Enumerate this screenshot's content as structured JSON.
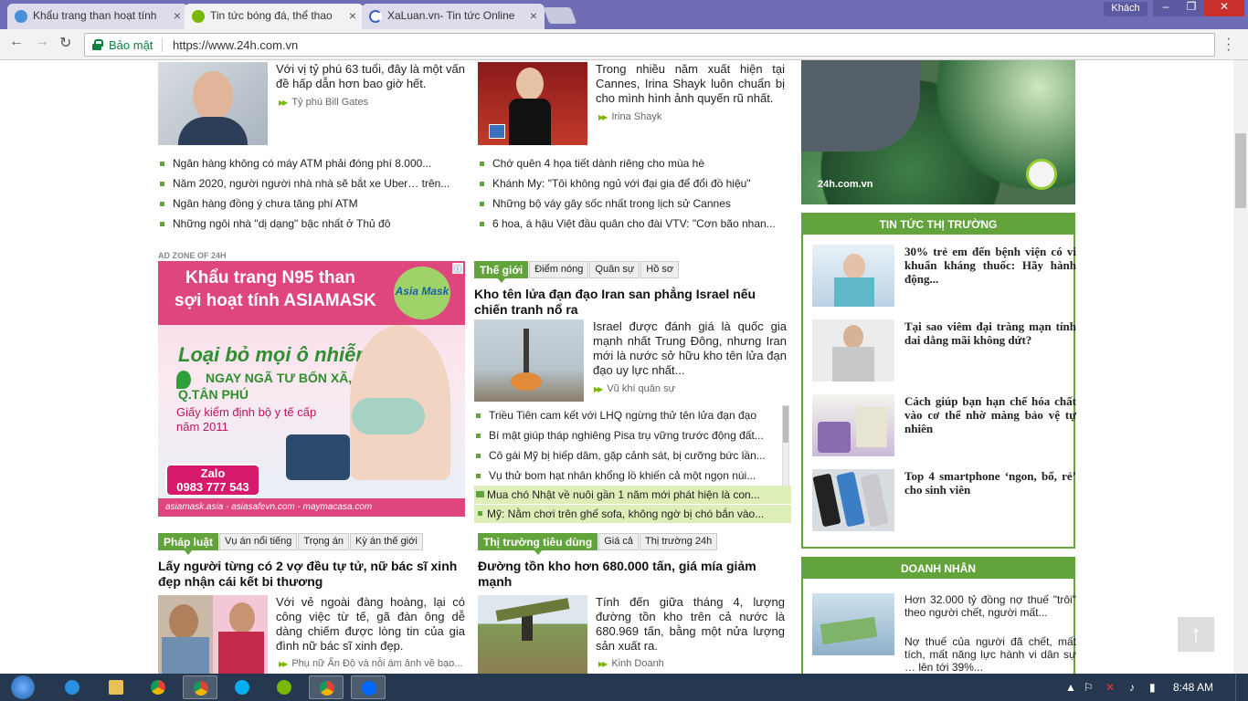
{
  "browser": {
    "tabs": [
      {
        "title": "Khẩu trang than hoạt tính"
      },
      {
        "title": "Tin tức bóng đá, thể thao"
      },
      {
        "title": "XaLuan.vn- Tin tức Online"
      }
    ],
    "guest_label": "Khách",
    "secure_label": "Bảo mật",
    "url": "https://www.24h.com.vn",
    "win_buttons": {
      "min": "–",
      "max": "❐",
      "close": "✕"
    }
  },
  "top_left": {
    "text": "Với vị tỷ phú 63 tuổi, đây là một vấn đề hấp dẫn hơn bao giờ hết.",
    "tag": "Tỷ phú Bill Gates",
    "links": [
      "Ngân hàng không có máy ATM phải đóng phí 8.000...",
      "Năm 2020, người người nhà nhà sẽ bắt xe Uber… trên...",
      "Ngân hàng đồng ý chưa tăng phí ATM",
      "Những ngôi nhà \"dị dạng\" bậc nhất ở Thủ đô"
    ]
  },
  "top_mid": {
    "text": "Trong nhiều năm xuất hiện tại Cannes, Irina Shayk luôn chuẩn bị cho mình hình ảnh quyến rũ nhất.",
    "tag": "Irina Shayk",
    "links": [
      "Chớ quên 4 họa tiết dành riêng cho mùa hè",
      "Khánh My: \"Tôi không ngủ với đại gia để đổi đồ hiệu\"",
      "Những bộ váy gây sốc nhất trong lịch sử Cannes",
      "6 hoa, á hậu Việt đầu quân cho đài VTV: \"Cơn bão nhan..."
    ]
  },
  "ad": {
    "zone_label": "AD ZONE OF 24H",
    "line1": "Khẩu trang N95 than",
    "line2": "sợi hoạt tính ASIAMASK",
    "brand": "Asia Mask",
    "headline": "Loại bỏ mọi ô nhiễm",
    "address1": "NGAY NGÃ TƯ BỐN XÃ,",
    "address2": "Q.TÂN PHÚ",
    "cert1": "Giấy kiểm định bộ y tế cấp",
    "cert2": "năm 2011",
    "zalo": "Zalo",
    "phone": "0983 777 543",
    "sites": "asiamask.asia - asiasafevn.com - maymacasa.com"
  },
  "world": {
    "tabs": [
      "Thế giới",
      "Điểm nóng",
      "Quân sự",
      "Hồ sơ"
    ],
    "headline": "Kho tên lửa đạn đạo Iran san phẳng Israel nếu chiến tranh nổ ra",
    "text": "Israel được đánh giá là quốc gia mạnh nhất Trung Đông, nhưng Iran mới là nước sở hữu kho tên lửa đạn đạo uy lực nhất...",
    "tag": "Vũ khí quân sự",
    "links": [
      "Triều Tiên cam kết với LHQ ngừng thử tên lửa đạn đạo",
      "Bí mật giúp tháp nghiêng Pisa trụ vững trước động đất...",
      "Cô gái Mỹ bị hiếp dâm, gặp cảnh sát, bị cưỡng bức lần...",
      "Vụ thử bom hạt nhân khổng lồ khiến cả một ngọn núi..."
    ],
    "video_links": [
      "Mua chó Nhật về nuôi gần 1 năm mới phát hiện là con...",
      "Mỹ: Nằm chơi trên ghế sofa, không ngờ bị chó bắn vào..."
    ]
  },
  "law": {
    "tabs": [
      "Pháp luật",
      "Vụ án nổi tiếng",
      "Trọng án",
      "Kỳ án thế giới"
    ],
    "headline": "Lấy người từng có 2 vợ đều tự tử, nữ bác sĩ xinh đẹp nhận cái kết bi thương",
    "text": "Với vẻ ngoài đàng hoàng, lại có công việc từ tế, gã đàn ông dễ dàng chiếm được lòng tin của gia đình nữ bác sĩ xinh đẹp.",
    "tag": "Phụ nữ Ấn Độ và nỗi ám ảnh về bạo..."
  },
  "market_col": {
    "tabs": [
      "Thị trường tiêu dùng",
      "Giá cả",
      "Thị trường 24h"
    ],
    "headline": "Đường tồn kho hơn 680.000 tấn, giá mía giảm mạnh",
    "text": "Tính đến giữa tháng 4, lượng đường tồn kho trên cả nước là 680.969 tấn, bằng một nửa lượng sản xuất ra.",
    "tag": "Kinh Doanh"
  },
  "sidebar": {
    "banner_watermark": "24h.com.vn",
    "market_title": "TIN TỨC THỊ TRƯỜNG",
    "market_items": [
      "30% trẻ em đến bệnh viện có vi khuẩn kháng thuốc: Hãy hành động...",
      "Tại sao viêm đại tràng mạn tính dai dẳng mãi không dứt?",
      "Cách giúp bạn hạn chế hóa chất vào cơ thể nhờ màng bảo vệ tự nhiên",
      "Top 4 smartphone ‘ngon, bổ, rẻ’ cho sinh viên"
    ],
    "business_title": "DOANH NHÂN",
    "business_headline": "Hơn 32.000 tỷ đồng nợ thuế \"trôi\" theo người chết, người mất...",
    "business_text": "Nợ thuế của người đã chết, mất tích, mất năng lực hành vi dân sự … lên tới 39%..."
  },
  "taskbar": {
    "time": "8:48 AM"
  },
  "colors": {
    "accent_green": "#62a33b",
    "tabbar": "#6f6db5",
    "taskbar": "#25384f"
  }
}
